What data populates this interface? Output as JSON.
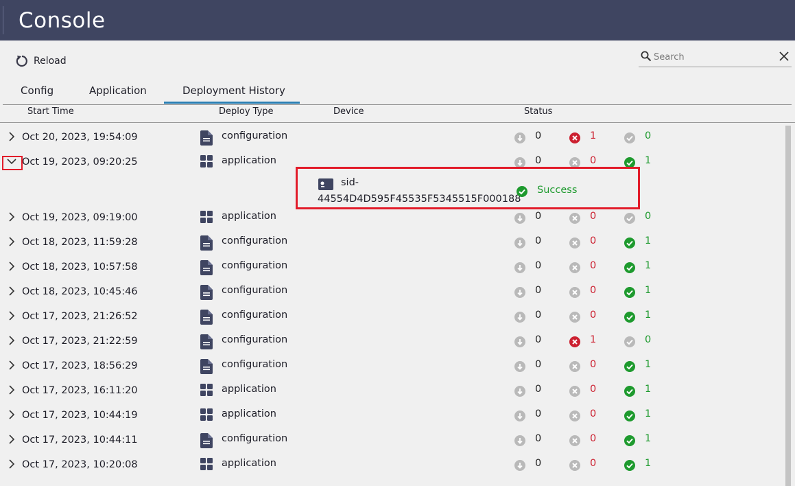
{
  "app": {
    "title": "Console"
  },
  "toolbar": {
    "reload_label": "Reload"
  },
  "search": {
    "placeholder": "Search",
    "value": ""
  },
  "tabs": [
    {
      "label": "Config",
      "active": false
    },
    {
      "label": "Application",
      "active": false
    },
    {
      "label": "Deployment History",
      "active": true
    }
  ],
  "columns": {
    "start_time": "Start Time",
    "deploy_type": "Deploy Type",
    "device": "Device",
    "status": "Status"
  },
  "colors": {
    "titlebar": "#3f4561",
    "accent": "#2a7fb4",
    "error": "#cc2030",
    "success": "#1e9a2e",
    "highlight": "#e21c2a"
  },
  "rows": [
    {
      "time": "Oct 20, 2023, 19:54:09",
      "type": "configuration",
      "icon": "document-icon",
      "pending": "0",
      "failed": "1",
      "success": "0",
      "expanded": false
    },
    {
      "time": "Oct 19, 2023, 09:20:25",
      "type": "application",
      "icon": "grid-icon",
      "pending": "0",
      "failed": "0",
      "success": "1",
      "expanded": true
    },
    {
      "time": "Oct 19, 2023, 09:19:00",
      "type": "application",
      "icon": "grid-icon",
      "pending": "0",
      "failed": "0",
      "success": "0",
      "expanded": false
    },
    {
      "time": "Oct 18, 2023, 11:59:28",
      "type": "configuration",
      "icon": "document-icon",
      "pending": "0",
      "failed": "0",
      "success": "1",
      "expanded": false
    },
    {
      "time": "Oct 18, 2023, 10:57:58",
      "type": "configuration",
      "icon": "document-icon",
      "pending": "0",
      "failed": "0",
      "success": "1",
      "expanded": false
    },
    {
      "time": "Oct 18, 2023, 10:45:46",
      "type": "configuration",
      "icon": "document-icon",
      "pending": "0",
      "failed": "0",
      "success": "1",
      "expanded": false
    },
    {
      "time": "Oct 17, 2023, 21:26:52",
      "type": "configuration",
      "icon": "document-icon",
      "pending": "0",
      "failed": "0",
      "success": "1",
      "expanded": false
    },
    {
      "time": "Oct 17, 2023, 21:22:59",
      "type": "configuration",
      "icon": "document-icon",
      "pending": "0",
      "failed": "1",
      "success": "0",
      "expanded": false
    },
    {
      "time": "Oct 17, 2023, 18:56:29",
      "type": "configuration",
      "icon": "document-icon",
      "pending": "0",
      "failed": "0",
      "success": "1",
      "expanded": false
    },
    {
      "time": "Oct 17, 2023, 16:11:20",
      "type": "application",
      "icon": "grid-icon",
      "pending": "0",
      "failed": "0",
      "success": "1",
      "expanded": false
    },
    {
      "time": "Oct 17, 2023, 10:44:19",
      "type": "application",
      "icon": "grid-icon",
      "pending": "0",
      "failed": "0",
      "success": "1",
      "expanded": false
    },
    {
      "time": "Oct 17, 2023, 10:44:11",
      "type": "configuration",
      "icon": "document-icon",
      "pending": "0",
      "failed": "0",
      "success": "1",
      "expanded": false
    },
    {
      "time": "Oct 17, 2023, 10:20:08",
      "type": "application",
      "icon": "grid-icon",
      "pending": "0",
      "failed": "0",
      "success": "1",
      "expanded": false
    }
  ],
  "detail": {
    "device_line1": "sid-",
    "device_line2": "44554D4D595F45535F5345515F000188",
    "status": "Success"
  }
}
